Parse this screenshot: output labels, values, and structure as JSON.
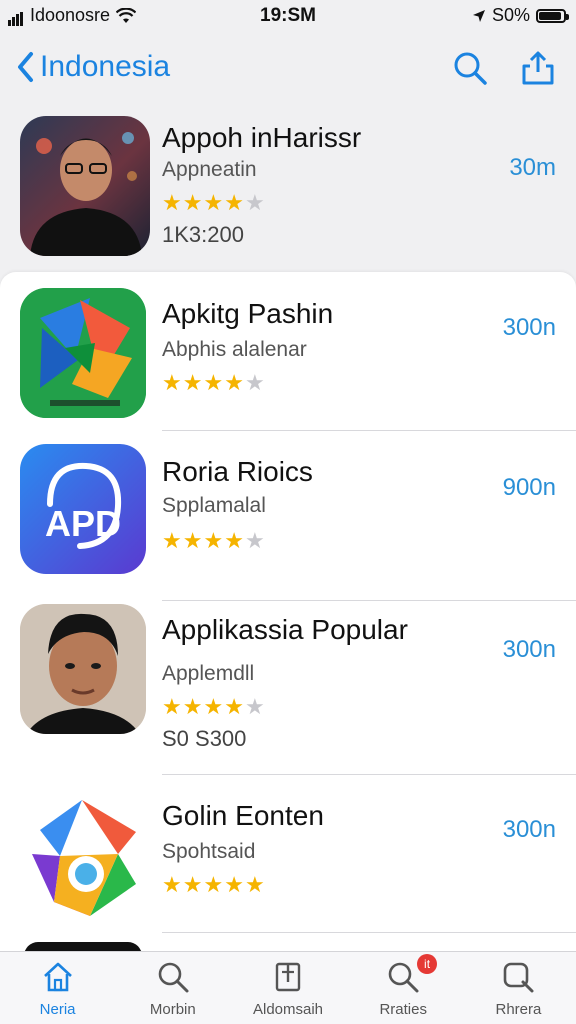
{
  "status_bar": {
    "carrier": "Idoonosre",
    "time": "19:SM",
    "battery": "S0%"
  },
  "nav": {
    "back_label": "Indonesia"
  },
  "featured": {
    "name": "Appoh inHarissr",
    "subtitle": "Appneatin",
    "rating": 4,
    "rating_count": "1K3:200",
    "price": "30m"
  },
  "apps": [
    {
      "name": "Apkitg Pashin",
      "subtitle": "Abphis alalenar",
      "rating": 3.5,
      "price": "300n"
    },
    {
      "name": "Roria Rioics",
      "subtitle": "Spplamalal",
      "rating": 4,
      "price": "900n",
      "icon_text": "APD"
    },
    {
      "name": "Applikassia Popular",
      "subtitle": "Applemdll",
      "rating": 4,
      "rating_count": "S0 S300",
      "price": "300n"
    },
    {
      "name": "Golin Eonten",
      "subtitle": "Spohtsaid",
      "rating": 4.5,
      "price": "300n"
    }
  ],
  "tabs": [
    {
      "label": "Neria",
      "icon": "home-icon",
      "active": true
    },
    {
      "label": "Morbin",
      "icon": "search-icon"
    },
    {
      "label": "Aldomsaih",
      "icon": "bookmark-icon"
    },
    {
      "label": "Rraties",
      "icon": "search-icon",
      "badge": "it"
    },
    {
      "label": "Rhrera",
      "icon": "search-icon"
    }
  ],
  "colors": {
    "accent": "#1b83e0",
    "star": "#f5b400",
    "price": "#2a8fd6"
  }
}
